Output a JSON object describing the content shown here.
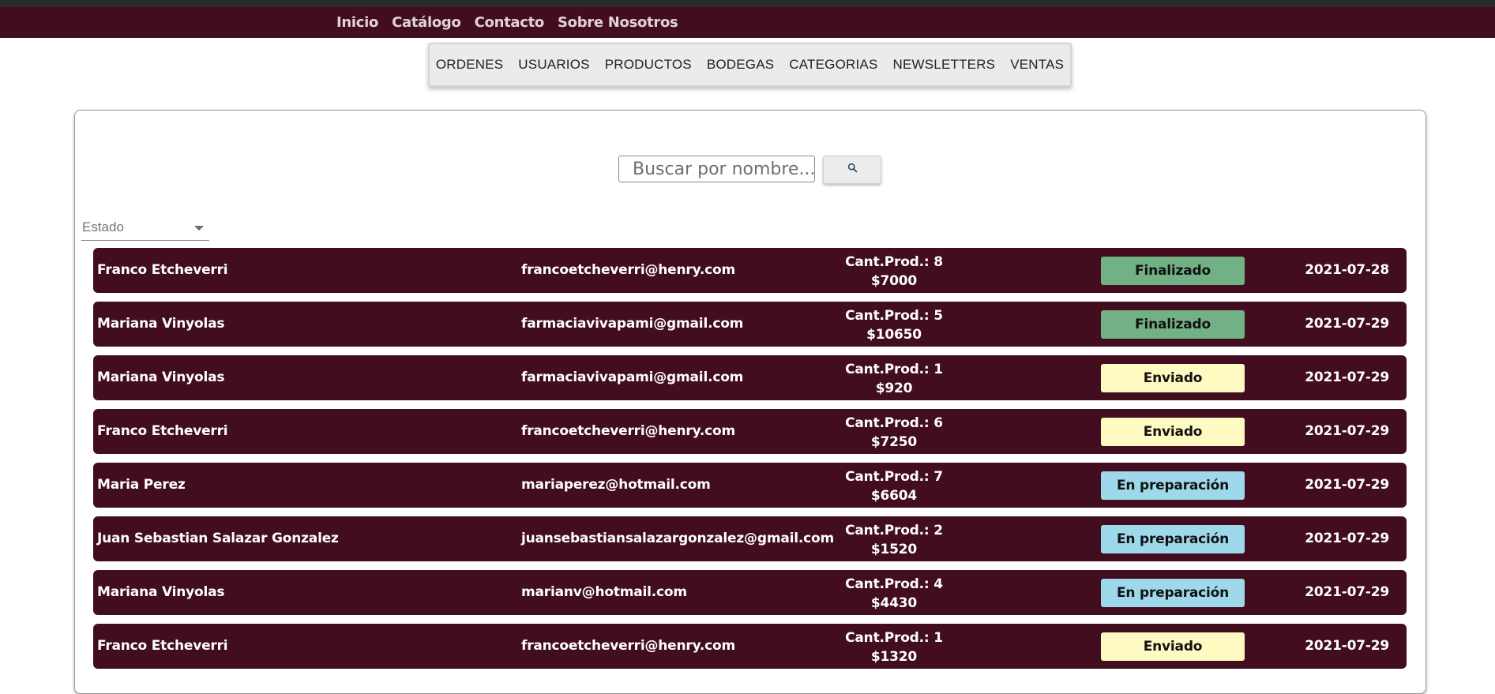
{
  "nav": {
    "links": [
      "Inicio",
      "Catálogo",
      "Contacto",
      "Sobre Nosotros"
    ]
  },
  "admin_menu": {
    "items": [
      "ORDENES",
      "USUARIOS",
      "PRODUCTOS",
      "BODEGAS",
      "CATEGORIAS",
      "NEWSLETTERS",
      "VENTAS"
    ]
  },
  "search": {
    "placeholder": "Buscar por nombre...",
    "icon": "search-icon"
  },
  "filter": {
    "label": "Estado",
    "icon": "caret-down-icon"
  },
  "status_colors": {
    "Finalizado": "#72b085",
    "Enviado": "#fffac2",
    "En preparación": "#9dd9ea"
  },
  "orders": [
    {
      "name": "Franco Etcheverri",
      "email": "francoetcheverri@henry.com",
      "qty": "Cant.Prod.: 8",
      "total": "$7000",
      "status": "Finalizado",
      "date": "2021-07-28"
    },
    {
      "name": "Mariana Vinyolas",
      "email": "farmaciavivapami@gmail.com",
      "qty": "Cant.Prod.: 5",
      "total": "$10650",
      "status": "Finalizado",
      "date": "2021-07-29"
    },
    {
      "name": "Mariana Vinyolas",
      "email": "farmaciavivapami@gmail.com",
      "qty": "Cant.Prod.: 1",
      "total": "$920",
      "status": "Enviado",
      "date": "2021-07-29"
    },
    {
      "name": "Franco Etcheverri",
      "email": "francoetcheverri@henry.com",
      "qty": "Cant.Prod.: 6",
      "total": "$7250",
      "status": "Enviado",
      "date": "2021-07-29"
    },
    {
      "name": "Maria Perez",
      "email": "mariaperez@hotmail.com",
      "qty": "Cant.Prod.: 7",
      "total": "$6604",
      "status": "En preparación",
      "date": "2021-07-29"
    },
    {
      "name": "Juan Sebastian Salazar Gonzalez",
      "email": "juansebastiansalazargonzalez@gmail.com",
      "qty": "Cant.Prod.: 2",
      "total": "$1520",
      "status": "En preparación",
      "date": "2021-07-29"
    },
    {
      "name": "Mariana Vinyolas",
      "email": "marianv@hotmail.com",
      "qty": "Cant.Prod.: 4",
      "total": "$4430",
      "status": "En preparación",
      "date": "2021-07-29"
    },
    {
      "name": "Franco Etcheverri",
      "email": "francoetcheverri@henry.com",
      "qty": "Cant.Prod.: 1",
      "total": "$1320",
      "status": "Enviado",
      "date": "2021-07-29"
    }
  ]
}
